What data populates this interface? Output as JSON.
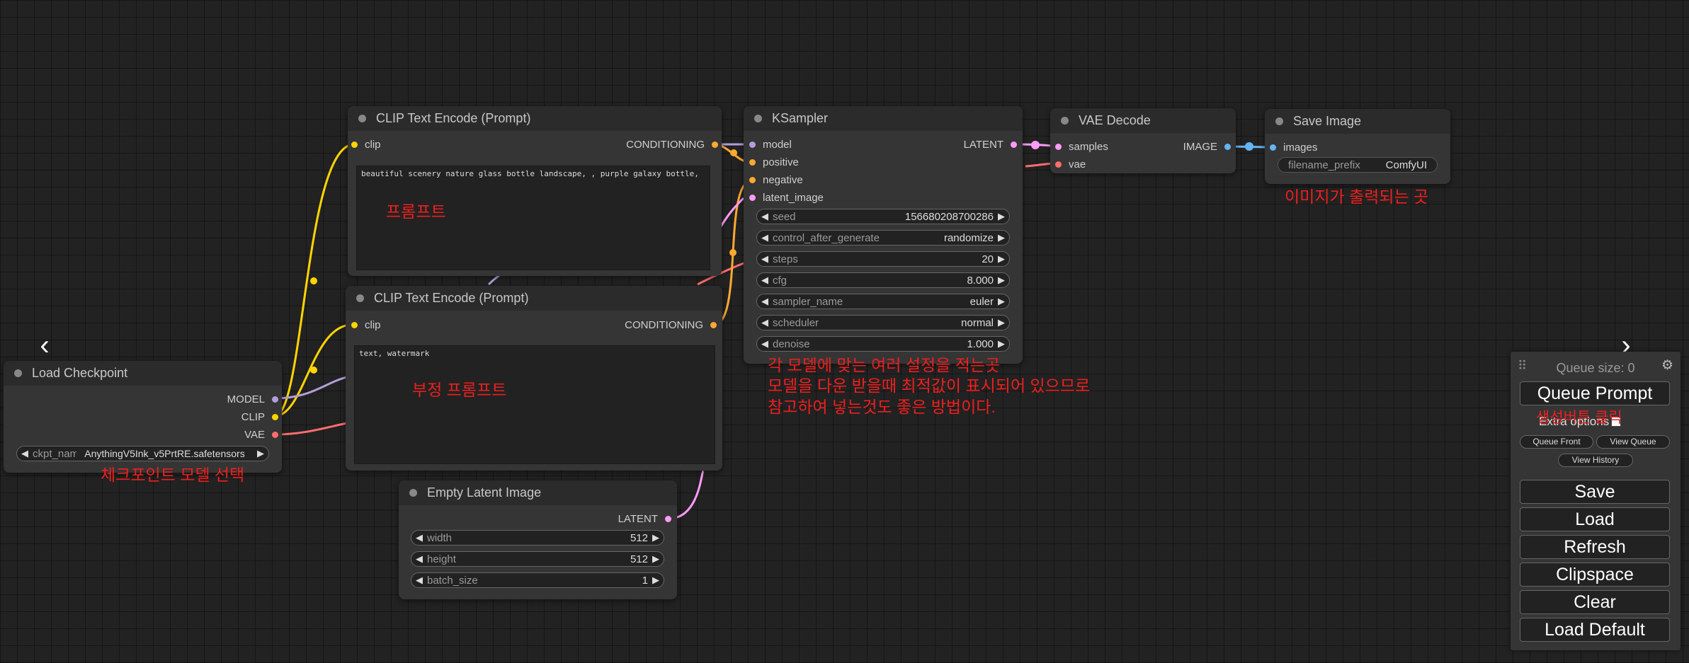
{
  "colors": {
    "canvas": "#222222",
    "node_body": "#353535",
    "node_title": "#2b2b2b",
    "annotation": "#ee1f1f",
    "link_clip": "#ffd500",
    "link_model": "#b39ddb",
    "link_vae": "#ff6e6e",
    "link_conditioning": "#ffa931",
    "link_latent": "#ff9cf9",
    "link_image": "#64b5f6"
  },
  "nodes": {
    "clip_pos": {
      "title": "CLIP Text Encode (Prompt)",
      "in_clip": "clip",
      "out_conditioning": "CONDITIONING",
      "text": "beautiful scenery nature glass bottle landscape, , purple galaxy bottle,"
    },
    "clip_neg": {
      "title": "CLIP Text Encode (Prompt)",
      "in_clip": "clip",
      "out_conditioning": "CONDITIONING",
      "text": "text, watermark"
    },
    "checkpoint": {
      "title": "Load Checkpoint",
      "out_model": "MODEL",
      "out_clip": "CLIP",
      "out_vae": "VAE",
      "ckpt_label": "ckpt_name",
      "ckpt_value": "AnythingV5Ink_v5PrtRE.safetensors"
    },
    "ksampler": {
      "title": "KSampler",
      "in_model": "model",
      "in_positive": "positive",
      "in_negative": "negative",
      "in_latent": "latent_image",
      "out_latent": "LATENT",
      "widgets": [
        {
          "label": "seed",
          "value": "156680208700286"
        },
        {
          "label": "control_after_generate",
          "value": "randomize"
        },
        {
          "label": "steps",
          "value": "20"
        },
        {
          "label": "cfg",
          "value": "8.000"
        },
        {
          "label": "sampler_name",
          "value": "euler"
        },
        {
          "label": "scheduler",
          "value": "normal"
        },
        {
          "label": "denoise",
          "value": "1.000"
        }
      ]
    },
    "vae_decode": {
      "title": "VAE Decode",
      "in_samples": "samples",
      "in_vae": "vae",
      "out_image": "IMAGE"
    },
    "save_image": {
      "title": "Save Image",
      "in_images": "images",
      "prefix_label": "filename_prefix",
      "prefix_value": "ComfyUI"
    },
    "empty_latent": {
      "title": "Empty Latent Image",
      "out_latent": "LATENT",
      "widgets": [
        {
          "label": "width",
          "value": "512"
        },
        {
          "label": "height",
          "value": "512"
        },
        {
          "label": "batch_size",
          "value": "1"
        }
      ]
    }
  },
  "annotations": {
    "prompt": "프롬프트",
    "negative_prompt": "부정 프롬프트",
    "checkpoint": "체크포인트 모델 선택",
    "output": "이미지가 출력되는 곳",
    "settings_1": "각 모델에 맞는  여러 설정을 적는곳",
    "settings_2": "모델을 다운 받을때 최적값이 표시되어 있으므로",
    "settings_3": "참고하여 넣는것도 좋은 방법이다.",
    "generate": "생성버튼 클릭"
  },
  "panel": {
    "queue_size": "Queue size: 0",
    "queue_prompt": "Queue Prompt",
    "extra_options": "Extra options",
    "queue_front": "Queue Front",
    "view_queue": "View Queue",
    "view_history": "View History",
    "save": "Save",
    "load": "Load",
    "refresh": "Refresh",
    "clipspace": "Clipspace",
    "clear": "Clear",
    "load_default": "Load Default"
  },
  "icons": {
    "prev": "chevron-left-icon",
    "next": "chevron-right-icon",
    "settings": "gear-icon",
    "drag": "drag-handle-icon"
  }
}
